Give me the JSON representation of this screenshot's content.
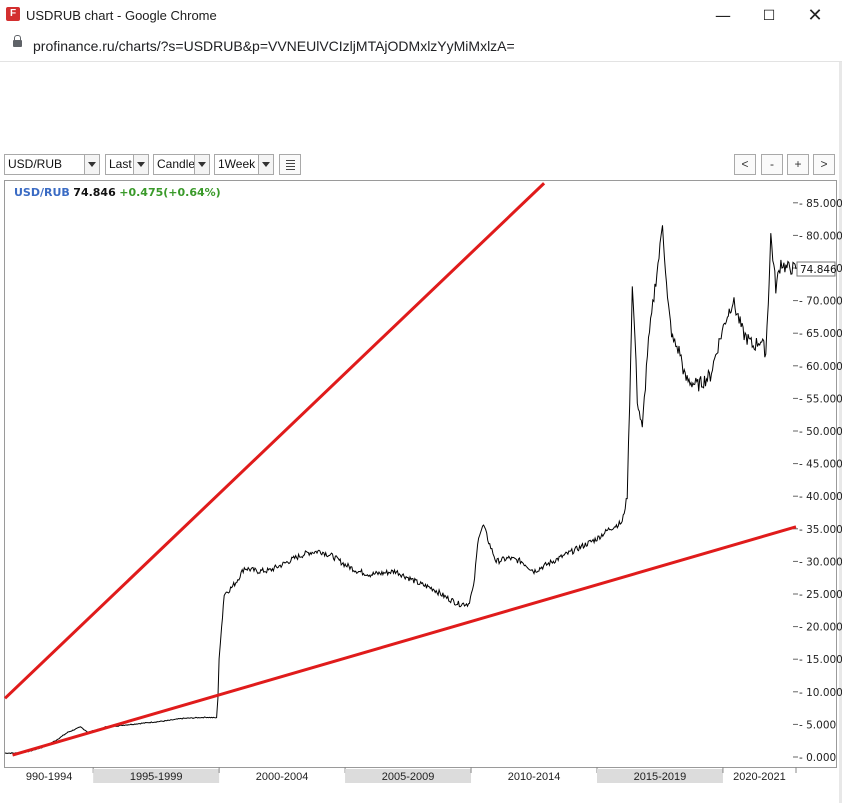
{
  "window": {
    "title": "USDRUB chart - Google Chrome",
    "favicon_letter": "F",
    "minimize_glyph": "—",
    "maximize_glyph": "☐",
    "close_glyph": "✕"
  },
  "address": {
    "url": "profinance.ru/charts/?s=USDRUB&p=VVNEUlVCIzljMTAjODMxlzYyMiMxlzA="
  },
  "toolbar": {
    "symbol": "USD/RUB",
    "price_type": "Last",
    "chart_style": "Candle",
    "interval": "1Week",
    "nav_prev": "<",
    "nav_zoom_out": "-",
    "nav_zoom_in": "+",
    "nav_next": ">"
  },
  "quote": {
    "symbol": "USD/RUB",
    "last": "74.846",
    "change": "+0.475(+0.64%)"
  },
  "colors": {
    "trendline": "#e01b1b",
    "price_line": "#000000",
    "symbol_text": "#3a6bc4",
    "change_text": "#3a9a2a"
  },
  "chart_data": {
    "type": "line",
    "ylim": [
      -1.5,
      86.5
    ],
    "yticks": [
      {
        "v": 0,
        "label": "0.000"
      },
      {
        "v": 5,
        "label": "5.000"
      },
      {
        "v": 10,
        "label": "10.000"
      },
      {
        "v": 15,
        "label": "15.000"
      },
      {
        "v": 20,
        "label": "20.000"
      },
      {
        "v": 25,
        "label": "25.000"
      },
      {
        "v": 30,
        "label": "30.000"
      },
      {
        "v": 35,
        "label": "35.000"
      },
      {
        "v": 40,
        "label": "40.000"
      },
      {
        "v": 45,
        "label": "45.000"
      },
      {
        "v": 50,
        "label": "50.000"
      },
      {
        "v": 55,
        "label": "55.000"
      },
      {
        "v": 60,
        "label": "60.000"
      },
      {
        "v": 65,
        "label": "65.000"
      },
      {
        "v": 70,
        "label": "70.000"
      },
      {
        "v": 75,
        "label": "75.000"
      },
      {
        "v": 80,
        "label": "80.000"
      },
      {
        "v": 85,
        "label": "85.000"
      }
    ],
    "xlim": [
      1990.0,
      2021.4
    ],
    "periods": [
      {
        "label": "990-1994",
        "start": 1990.0,
        "end": 1993.5,
        "shaded": false
      },
      {
        "label": "1995-1999",
        "start": 1993.5,
        "end": 1998.5,
        "shaded": true
      },
      {
        "label": "2000-2004",
        "start": 1998.5,
        "end": 2003.5,
        "shaded": false
      },
      {
        "label": "2005-2009",
        "start": 2003.5,
        "end": 2008.5,
        "shaded": true
      },
      {
        "label": "2010-2014",
        "start": 2008.5,
        "end": 2013.5,
        "shaded": false
      },
      {
        "label": "2015-2019",
        "start": 2013.5,
        "end": 2018.5,
        "shaded": true
      },
      {
        "label": "2020-2021",
        "start": 2018.5,
        "end": 2021.4,
        "shaded": false
      }
    ],
    "last_value": 74.846,
    "last_label": "74.846",
    "series": [
      {
        "x": [
          1990.0,
          1990.5,
          1991.0,
          1991.5,
          1992.0,
          1992.5,
          1993.0,
          1993.3,
          1993.7,
          1994.0,
          1994.5,
          1995.0,
          1995.5,
          1996.0,
          1996.5,
          1997.0,
          1997.5,
          1998.0,
          1998.4,
          1998.45,
          1998.5,
          1998.6,
          1998.7,
          1999.0,
          1999.2,
          1999.5,
          2000.0,
          2000.5,
          2001.0,
          2001.5,
          2002.0,
          2002.5,
          2003.0,
          2003.5,
          2004.0,
          2004.5,
          2005.0,
          2005.5,
          2006.0,
          2006.5,
          2007.0,
          2007.5,
          2008.0,
          2008.4,
          2008.6,
          2008.8,
          2009.0,
          2009.2,
          2009.5,
          2010.0,
          2010.5,
          2011.0,
          2011.5,
          2012.0,
          2012.5,
          2013.0,
          2013.5,
          2014.0,
          2014.5,
          2014.7,
          2014.8,
          2014.9,
          2015.0,
          2015.1,
          2015.3,
          2015.5,
          2015.8,
          2016.0,
          2016.1,
          2016.3,
          2016.5,
          2016.8,
          2017.0,
          2017.5,
          2018.0,
          2018.3,
          2018.6,
          2018.9,
          2019.3,
          2019.7,
          2020.0,
          2020.2,
          2020.3,
          2020.4,
          2020.6,
          2020.8,
          2021.0,
          2021.2,
          2021.4
        ],
        "y": [
          0.6,
          0.6,
          0.9,
          1.5,
          2.5,
          3.8,
          4.6,
          3.8,
          4.2,
          4.6,
          4.8,
          5.0,
          5.2,
          5.4,
          5.6,
          5.9,
          6.0,
          6.1,
          6.0,
          9.0,
          15.0,
          20.0,
          25.0,
          26.0,
          27.0,
          29.0,
          28.5,
          28.6,
          29.5,
          30.5,
          31.3,
          31.6,
          30.8,
          29.5,
          28.5,
          28.0,
          28.2,
          28.5,
          27.5,
          26.5,
          25.8,
          24.5,
          23.5,
          23.5,
          26.0,
          34.0,
          35.5,
          33.0,
          30.0,
          30.5,
          30.0,
          28.5,
          29.5,
          30.5,
          31.5,
          32.5,
          33.5,
          35.0,
          36.0,
          40.0,
          55.0,
          72.0,
          65.0,
          55.0,
          50.0,
          62.0,
          72.0,
          78.0,
          82.0,
          70.0,
          64.0,
          62.0,
          58.0,
          57.0,
          58.5,
          63.0,
          67.0,
          70.0,
          65.0,
          63.0,
          64.0,
          62.0,
          70.0,
          80.0,
          72.0,
          76.0,
          75.0,
          75.0,
          74.846
        ]
      }
    ],
    "trendlines": [
      {
        "x": [
          1990.0,
          2011.4
        ],
        "y": [
          9.0,
          88.0
        ]
      },
      {
        "x": [
          1990.3,
          2021.4
        ],
        "y": [
          0.3,
          35.3
        ]
      }
    ]
  }
}
